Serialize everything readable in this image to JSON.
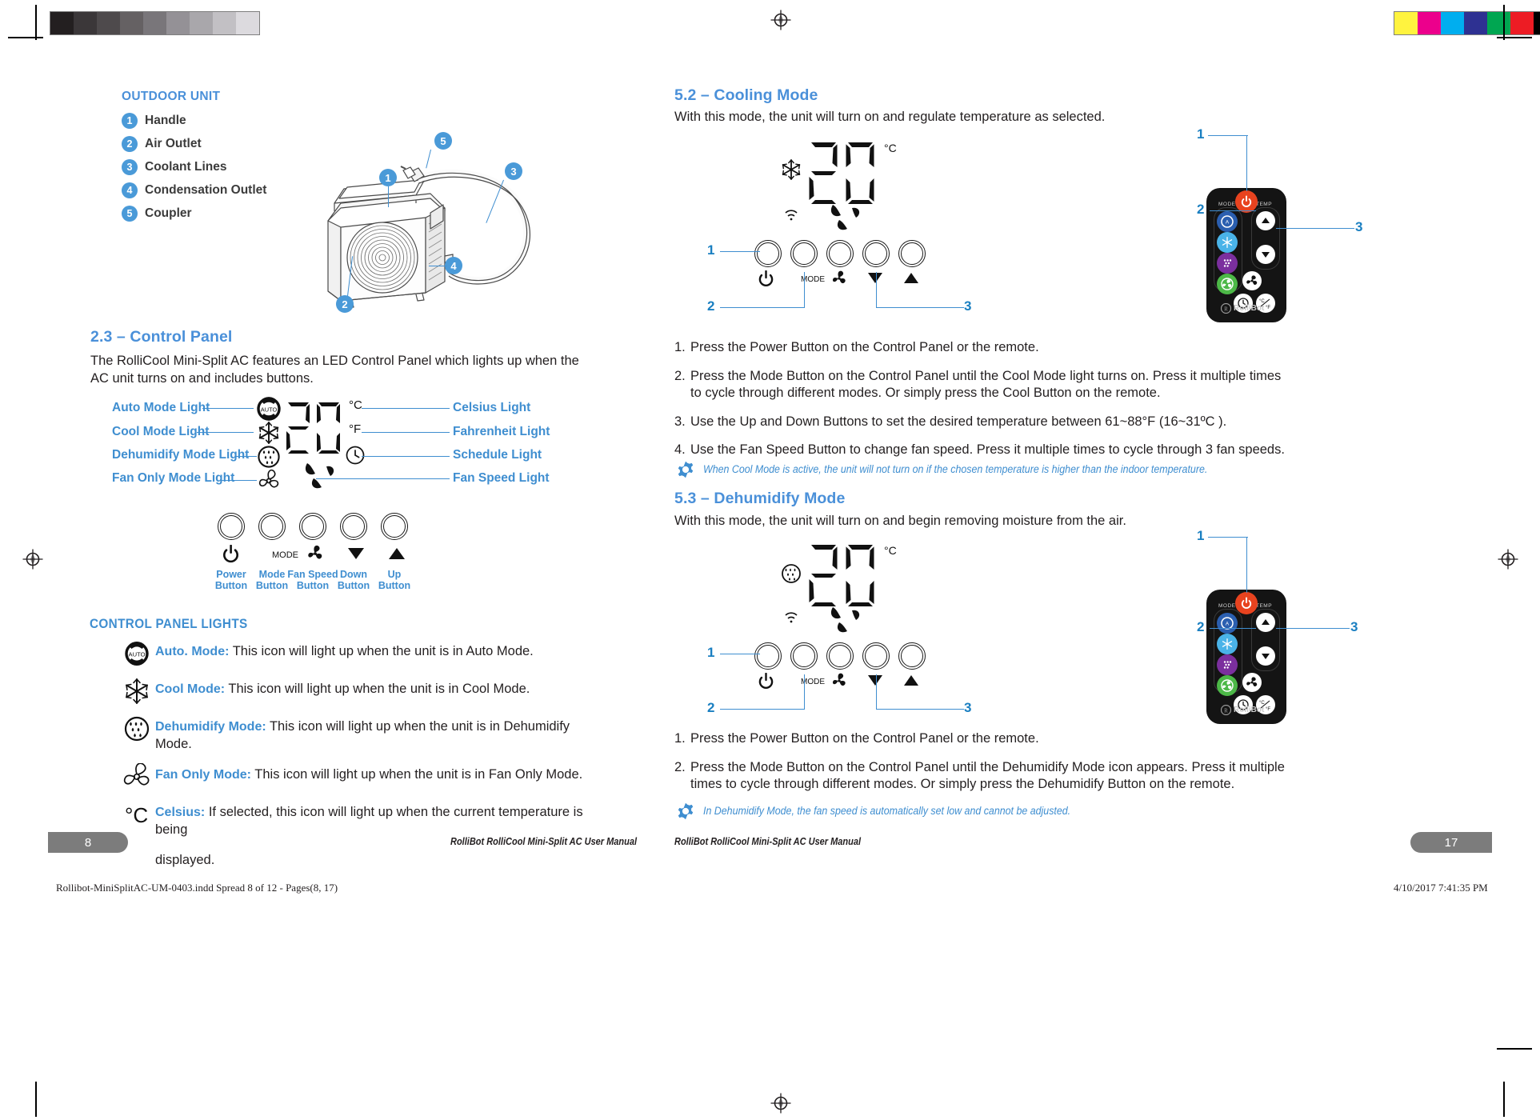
{
  "calibration": {
    "grayscale": [
      "#231f20",
      "#3b3739",
      "#4e4a4c",
      "#656163",
      "#79767a",
      "#949196",
      "#a9a7ab",
      "#c2c0c4",
      "#dcdade"
    ],
    "colors": [
      "#fff33f",
      "#ec008c",
      "#00aeef",
      "#2e3192",
      "#00a651",
      "#ed1c24",
      "#000000",
      "#fff37a",
      "#f578b4",
      "#79d2f5",
      "#939598"
    ]
  },
  "left_page": {
    "legend": {
      "title": "OUTDOOR UNIT",
      "items": [
        {
          "num": "1",
          "label": "Handle"
        },
        {
          "num": "2",
          "label": "Air Outlet"
        },
        {
          "num": "3",
          "label": "Coolant Lines"
        },
        {
          "num": "4",
          "label": "Condensation Outlet"
        },
        {
          "num": "5",
          "label": "Coupler"
        }
      ]
    },
    "diagram_callouts": [
      "1",
      "2",
      "3",
      "4",
      "5"
    ],
    "control_panel": {
      "heading": "2.3 – Control Panel",
      "intro": "The RolliCool Mini-Split AC features an LED Control Panel which lights up when the AC unit turns on and includes buttons.",
      "left_labels": [
        "Auto Mode Light",
        "Cool Mode Light",
        "Dehumidify Mode Light",
        "Fan Only Mode Light"
      ],
      "right_labels": [
        "Celsius Light",
        "Fahrenheit Light",
        "Schedule Light",
        "Fan Speed Light"
      ],
      "display_value": "20",
      "unit_celsius": "°C",
      "unit_fahrenheit": "°F",
      "buttons": [
        {
          "icon": "power-icon",
          "line1": "Power",
          "line2": "Button"
        },
        {
          "icon": "mode-text-icon",
          "line1": "Mode",
          "line2": "Button"
        },
        {
          "icon": "fan-speed-icon",
          "line1": "Fan Speed",
          "line2": "Button"
        },
        {
          "icon": "down-arrow-icon",
          "line1": "Down",
          "line2": "Button"
        },
        {
          "icon": "up-arrow-icon",
          "line1": "Up",
          "line2": "Button"
        }
      ],
      "mode_button_text": "MODE"
    },
    "lights_section": {
      "heading": "CONTROL PANEL LIGHTS",
      "items": [
        {
          "icon": "auto-mode-icon",
          "term": "Auto. Mode:",
          "desc": "This icon will light up when the unit is in Auto Mode."
        },
        {
          "icon": "snowflake-icon",
          "term": "Cool Mode:",
          "desc": "This icon will light up when the unit is in Cool Mode."
        },
        {
          "icon": "dehumidify-icon",
          "term": "Dehumidify Mode:",
          "desc": "This icon will light up when the unit is in Dehumidify Mode."
        },
        {
          "icon": "fan-icon",
          "term": "Fan Only Mode:",
          "desc": "This icon will light up when the unit is in Fan Only Mode."
        },
        {
          "icon": "celsius-icon",
          "term": "Celsius:",
          "desc": "If selected, this icon will light up when the current temperature is being"
        },
        {
          "icon": "none",
          "term": "",
          "desc": "displayed."
        }
      ]
    },
    "footer": {
      "page_number": "8",
      "manual_title": "RolliBot RolliCool Mini-Split AC User Manual",
      "print_info": "Rollibot-MiniSplitAC-UM-0403.indd   Spread 8 of 12 - Pages(8, 17)"
    }
  },
  "right_page": {
    "cooling": {
      "heading": "5.2 – Cooling Mode",
      "intro": "With this mode, the unit will turn on and regulate temperature as selected.",
      "display_value": "20",
      "display_unit": "°C",
      "callouts": [
        "1",
        "2",
        "3"
      ],
      "steps": [
        {
          "num": "1.",
          "text": "Press the Power Button on the Control Panel or the remote."
        },
        {
          "num": "2.",
          "text": "Press the Mode Button on the Control Panel until the Cool Mode light turns on. Press it multiple times to cycle through different modes. Or simply press the Cool Button on the remote."
        },
        {
          "num": "3.",
          "text": "Use the Up and Down Buttons to set the desired temperature between 61~88°F (16~31ºC )."
        },
        {
          "num": "4.",
          "text": "Use the Fan Speed Button to change fan speed. Press it multiple times to cycle through 3 fan speeds."
        }
      ],
      "note": "When Cool Mode is active, the unit will not turn on if the chosen temperature is higher than the indoor temperature."
    },
    "dehumidify": {
      "heading": "5.3 – Dehumidify Mode",
      "intro": "With this mode, the unit will turn on and begin removing moisture from the air.",
      "display_value": "20",
      "display_unit": "°C",
      "callouts": [
        "1",
        "2",
        "3"
      ],
      "steps": [
        {
          "num": "1.",
          "text": "Press the Power Button on the Control Panel or the remote."
        },
        {
          "num": "2.",
          "text": "Press the Mode Button on the Control Panel until the Dehumidify Mode icon appears. Press it multiple times to cycle through different modes. Or simply press the Dehumidify Button on the remote."
        }
      ],
      "note": "In Dehumidify Mode, the fan speed is automatically set low and cannot be adjusted."
    },
    "remote": {
      "brand": "RolliBot",
      "mode_caption": "MODE",
      "temp_caption": "TEMP",
      "buttons": [
        {
          "name": "power-button",
          "color": "#e8431f"
        },
        {
          "name": "auto-mode-button",
          "color": "#2b5fb0"
        },
        {
          "name": "cool-mode-button",
          "color": "#4ab3e8"
        },
        {
          "name": "dehumidify-mode-button",
          "color": "#7b2f9e"
        },
        {
          "name": "fan-mode-button",
          "color": "#4cb847"
        },
        {
          "name": "temp-up-button",
          "color": "#ffffff"
        },
        {
          "name": "temp-down-button",
          "color": "#ffffff"
        },
        {
          "name": "fan-speed-button",
          "color": "#ffffff"
        },
        {
          "name": "timer-button",
          "color": "#ffffff"
        },
        {
          "name": "unit-toggle-button",
          "color": "#ffffff"
        }
      ],
      "unit_toggle_label": "°C/°F"
    },
    "footer": {
      "page_number": "17",
      "manual_title": "RolliBot RolliCool Mini-Split AC User Manual",
      "print_timestamp": "4/10/2017   7:41:35 PM"
    }
  }
}
